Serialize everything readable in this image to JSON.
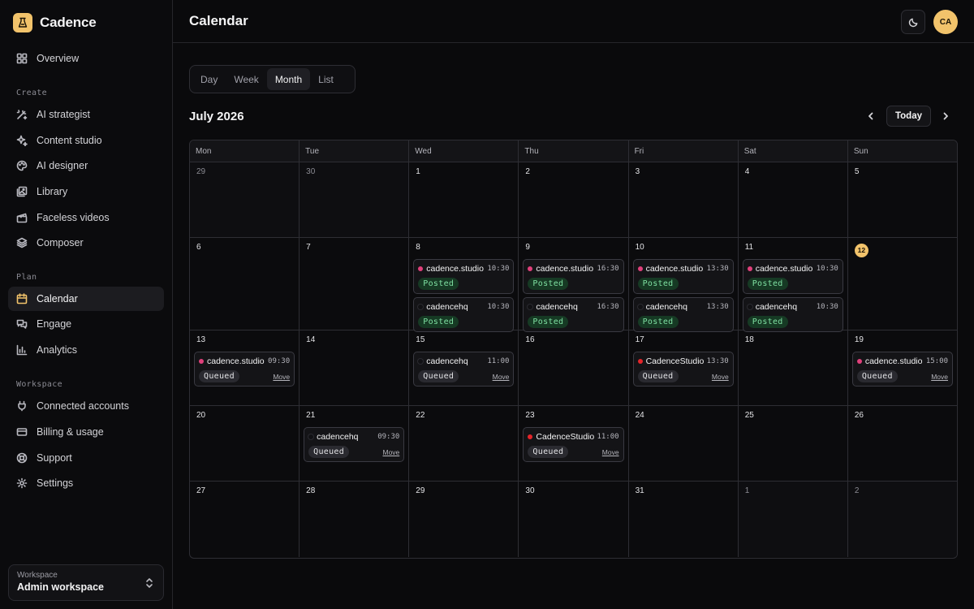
{
  "app": {
    "name": "Cadence"
  },
  "header": {
    "title": "Calendar",
    "avatar_initials": "CA"
  },
  "sidebar": {
    "top_items": [
      {
        "label": "Overview",
        "icon": "grid-icon"
      }
    ],
    "sections": [
      {
        "label": "Create",
        "items": [
          {
            "label": "AI strategist",
            "icon": "magic-wand-icon"
          },
          {
            "label": "Content studio",
            "icon": "sparkles-icon"
          },
          {
            "label": "AI designer",
            "icon": "palette-icon"
          },
          {
            "label": "Library",
            "icon": "images-icon"
          },
          {
            "label": "Faceless videos",
            "icon": "clapperboard-icon"
          },
          {
            "label": "Composer",
            "icon": "layers-icon"
          }
        ]
      },
      {
        "label": "Plan",
        "items": [
          {
            "label": "Calendar",
            "icon": "calendar-icon",
            "active": true
          },
          {
            "label": "Engage",
            "icon": "messages-icon"
          },
          {
            "label": "Analytics",
            "icon": "bar-chart-icon"
          }
        ]
      },
      {
        "label": "Workspace",
        "items": [
          {
            "label": "Connected accounts",
            "icon": "plug-icon"
          },
          {
            "label": "Billing & usage",
            "icon": "credit-card-icon"
          },
          {
            "label": "Support",
            "icon": "lifebuoy-icon"
          },
          {
            "label": "Settings",
            "icon": "gear-icon"
          }
        ]
      }
    ],
    "workspace": {
      "label": "Workspace",
      "name": "Admin workspace"
    }
  },
  "views": {
    "tabs": [
      "Day",
      "Week",
      "Month",
      "List"
    ],
    "active": "Month"
  },
  "calendar": {
    "month_label": "July 2026",
    "today_label": "Today",
    "weekdays": [
      "Mon",
      "Tue",
      "Wed",
      "Thu",
      "Fri",
      "Sat",
      "Sun"
    ],
    "colors": {
      "pink": "#e0407b",
      "black": "#111114",
      "red": "#e5252a",
      "accent": "#f2c36b",
      "posted_bg": "#163a24",
      "posted_fg": "#7fe0a2"
    },
    "move_label": "Move",
    "weeks": [
      [
        {
          "day": "29",
          "muted": true
        },
        {
          "day": "30",
          "muted": true
        },
        {
          "day": "1"
        },
        {
          "day": "2"
        },
        {
          "day": "3"
        },
        {
          "day": "4"
        },
        {
          "day": "5"
        }
      ],
      [
        {
          "day": "6"
        },
        {
          "day": "7"
        },
        {
          "day": "8",
          "posts": [
            {
              "account": "cadence.studio",
              "time": "10:30",
              "status": "Posted",
              "dot": "pink"
            },
            {
              "account": "cadencehq",
              "time": "10:30",
              "status": "Posted",
              "dot": "black"
            }
          ]
        },
        {
          "day": "9",
          "posts": [
            {
              "account": "cadence.studio",
              "time": "16:30",
              "status": "Posted",
              "dot": "pink"
            },
            {
              "account": "cadencehq",
              "time": "16:30",
              "status": "Posted",
              "dot": "black"
            }
          ]
        },
        {
          "day": "10",
          "posts": [
            {
              "account": "cadence.studio",
              "time": "13:30",
              "status": "Posted",
              "dot": "pink"
            },
            {
              "account": "cadencehq",
              "time": "13:30",
              "status": "Posted",
              "dot": "black"
            }
          ]
        },
        {
          "day": "11",
          "posts": [
            {
              "account": "cadence.studio",
              "time": "10:30",
              "status": "Posted",
              "dot": "pink"
            },
            {
              "account": "cadencehq",
              "time": "10:30",
              "status": "Posted",
              "dot": "black"
            }
          ]
        },
        {
          "day": "12",
          "today": true
        }
      ],
      [
        {
          "day": "13",
          "posts": [
            {
              "account": "cadence.studio",
              "time": "09:30",
              "status": "Queued",
              "dot": "pink"
            }
          ]
        },
        {
          "day": "14"
        },
        {
          "day": "15",
          "posts": [
            {
              "account": "cadencehq",
              "time": "11:00",
              "status": "Queued",
              "dot": "black"
            }
          ]
        },
        {
          "day": "16"
        },
        {
          "day": "17",
          "posts": [
            {
              "account": "CadenceStudio",
              "time": "13:30",
              "status": "Queued",
              "dot": "red"
            }
          ]
        },
        {
          "day": "18"
        },
        {
          "day": "19",
          "posts": [
            {
              "account": "cadence.studio",
              "time": "15:00",
              "status": "Queued",
              "dot": "pink"
            }
          ]
        }
      ],
      [
        {
          "day": "20"
        },
        {
          "day": "21",
          "posts": [
            {
              "account": "cadencehq",
              "time": "09:30",
              "status": "Queued",
              "dot": "black"
            }
          ]
        },
        {
          "day": "22"
        },
        {
          "day": "23",
          "posts": [
            {
              "account": "CadenceStudio",
              "time": "11:00",
              "status": "Queued",
              "dot": "red"
            }
          ]
        },
        {
          "day": "24"
        },
        {
          "day": "25"
        },
        {
          "day": "26"
        }
      ],
      [
        {
          "day": "27"
        },
        {
          "day": "28"
        },
        {
          "day": "29"
        },
        {
          "day": "30"
        },
        {
          "day": "31"
        },
        {
          "day": "1",
          "muted": true
        },
        {
          "day": "2",
          "muted": true
        }
      ]
    ]
  }
}
